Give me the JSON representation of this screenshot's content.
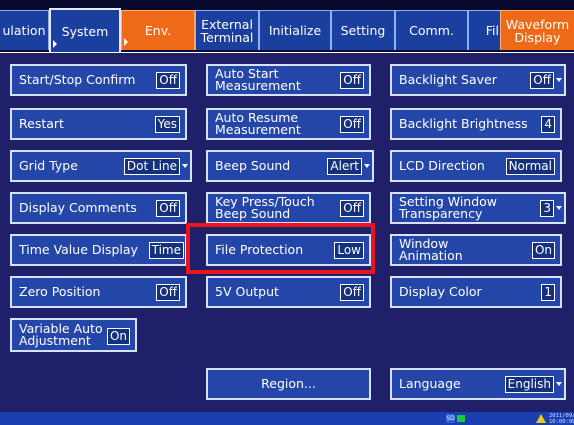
{
  "tabs": [
    {
      "label": "ulation",
      "name": "tab-calculation"
    },
    {
      "label": "System",
      "name": "tab-system"
    },
    {
      "label": "Env.",
      "name": "tab-env"
    },
    {
      "label": "External Terminal",
      "name": "tab-external-terminal"
    },
    {
      "label": "Initialize",
      "name": "tab-initialize"
    },
    {
      "label": "Setting",
      "name": "tab-setting"
    },
    {
      "label": "Comm.",
      "name": "tab-comm"
    },
    {
      "label": "Fil",
      "name": "tab-file"
    },
    {
      "label": "Waveform Display",
      "name": "tab-waveform-display"
    }
  ],
  "settings": {
    "start_stop_confirm": {
      "label": "Start/Stop Confirm",
      "value": "Off"
    },
    "restart": {
      "label": "Restart",
      "value": "Yes"
    },
    "grid_type": {
      "label": "Grid Type",
      "value": "Dot Line"
    },
    "display_comments": {
      "label": "Display Comments",
      "value": "Off"
    },
    "time_value_display": {
      "label": "Time Value Display",
      "value": "Time"
    },
    "zero_position": {
      "label": "Zero Position",
      "value": "Off"
    },
    "variable_auto_adjustment": {
      "label": "Variable Auto Adjustment",
      "value": "On"
    },
    "auto_start_measurement": {
      "label": "Auto Start Measurement",
      "value": "Off"
    },
    "auto_resume_measurement": {
      "label": "Auto Resume Measurement",
      "value": "Off"
    },
    "beep_sound": {
      "label": "Beep Sound",
      "value": "Alert"
    },
    "key_press_touch_beep_sound": {
      "label": "Key Press/Touch Beep Sound",
      "value": "Off"
    },
    "file_protection": {
      "label": "File Protection",
      "value": "Low"
    },
    "output_5v": {
      "label": "5V Output",
      "value": "Off"
    },
    "backlight_saver": {
      "label": "Backlight Saver",
      "value": "Off"
    },
    "backlight_brightness": {
      "label": "Backlight Brightness",
      "value": "4"
    },
    "lcd_direction": {
      "label": "LCD Direction",
      "value": "Normal"
    },
    "setting_window_transparency": {
      "label": "Setting Window Transparency",
      "value": "3"
    },
    "window_animation": {
      "label": "Window Animation",
      "value": "On"
    },
    "display_color": {
      "label": "Display Color",
      "value": "1"
    },
    "language": {
      "label": "Language",
      "value": "English"
    }
  },
  "region_button": {
    "label": "Region..."
  },
  "status": {
    "sd": "SD",
    "date": "2011/09/05",
    "time": "10:00:00"
  },
  "colors": {
    "highlight": "#e8141e",
    "accent_tab": "#ef6a18",
    "tab_blue": "#1b3f9e",
    "panel": "#1f1f6a"
  }
}
